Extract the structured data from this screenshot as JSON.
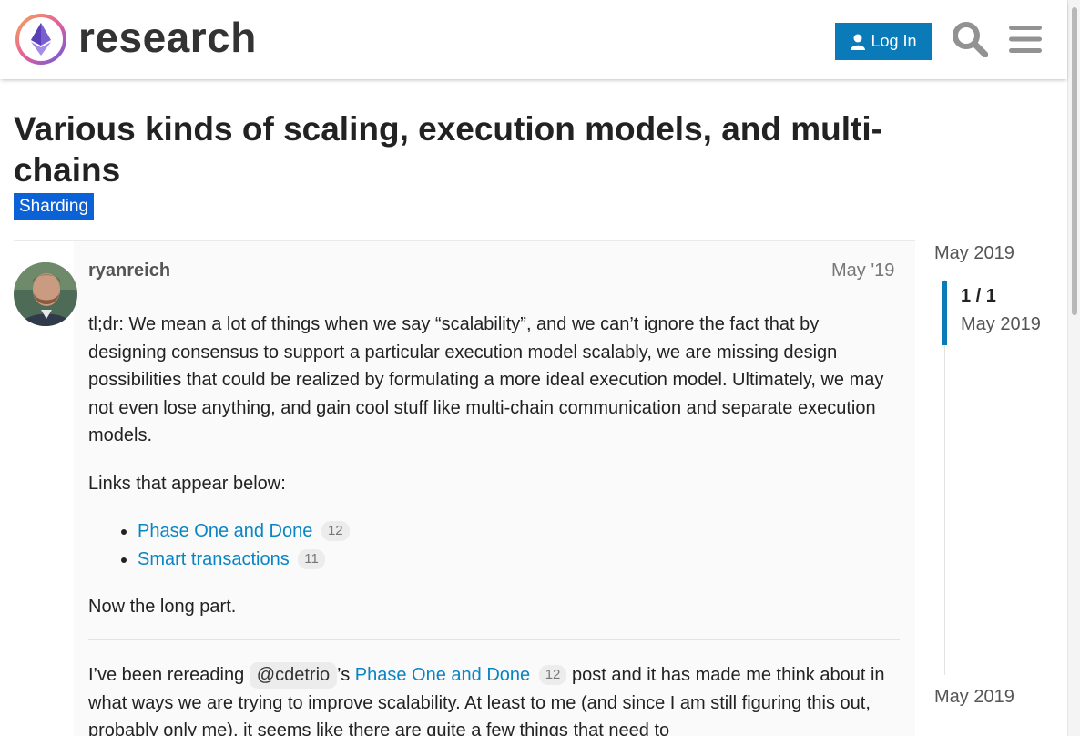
{
  "header": {
    "site_name": "research",
    "login_label": "Log In"
  },
  "topic": {
    "title": "Various kinds of scaling, execution models, and multi-chains",
    "category": "Sharding",
    "category_color": "#0b62d7"
  },
  "post": {
    "username": "ryanreich",
    "date": "May '19",
    "paragraph_1": "tl;dr: We mean a lot of things when we say “scalability”, and we can’t ignore the fact that by designing consensus to support a particular execution model scalably, we are missing design possibilities that could be realized by formulating a more ideal execution model. Ultimately, we may not even lose anything, and gain cool stuff like multi-chain communication and separate execution models.",
    "paragraph_2": "Links that appear below:",
    "links": [
      {
        "text": "Phase One and Done",
        "count": "12"
      },
      {
        "text": "Smart transactions",
        "count": "11"
      }
    ],
    "paragraph_3": "Now the long part.",
    "p4_before": "I’ve been rereading ",
    "p4_mention": "@cdetrio",
    "p4_mid": "’s ",
    "p4_link": "Phase One and Done",
    "p4_link_count": "12",
    "p4_after": " post and it has made me think about in what ways we are trying to improve scalability. At least to me (and since I am still figuring this out, probably only me), it seems like there are quite a few things that need to"
  },
  "timeline": {
    "top_date": "May 2019",
    "position": "1 / 1",
    "position_date": "May 2019",
    "bottom_date": "May 2019"
  },
  "colors": {
    "accent": "#0a7ab8",
    "link": "#0a85c4"
  },
  "icons": [
    "ethereum-logo-icon",
    "user-icon",
    "search-icon",
    "hamburger-menu-icon"
  ]
}
